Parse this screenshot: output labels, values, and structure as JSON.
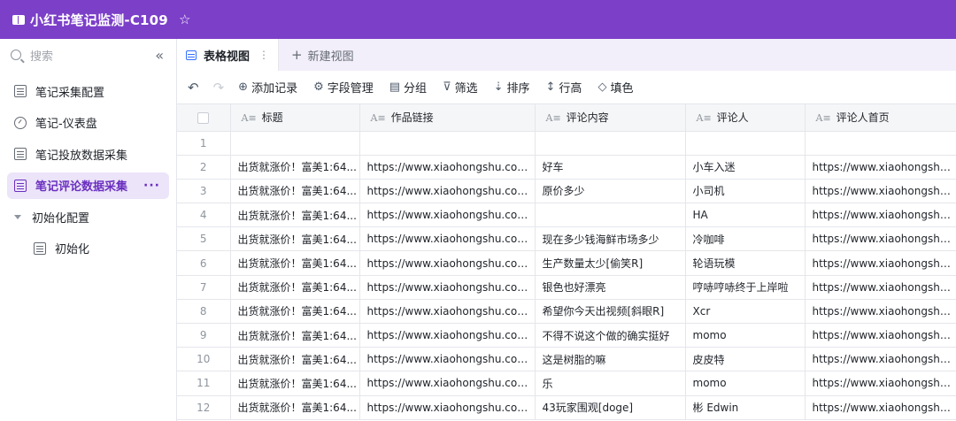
{
  "app": {
    "title": "小红书笔记监测-C109"
  },
  "sidebar": {
    "search_placeholder": "搜索",
    "collapse_glyph": "«",
    "items": [
      {
        "label": "笔记采集配置"
      },
      {
        "label": "笔记-仪表盘"
      },
      {
        "label": "笔记投放数据采集"
      },
      {
        "label": "笔记评论数据采集"
      },
      {
        "label": "初始化配置"
      },
      {
        "label": "初始化"
      }
    ]
  },
  "tabs": {
    "active": "表格视图",
    "new_view": "新建视图"
  },
  "toolbar": {
    "add_record": "添加记录",
    "field_manage": "字段管理",
    "group": "分组",
    "filter": "筛选",
    "sort": "排序",
    "row_height": "行高",
    "fill": "填色"
  },
  "table": {
    "columns": [
      "标题",
      "作品链接",
      "评论内容",
      "评论人",
      "评论人首页"
    ],
    "rows": [
      {
        "n": "1",
        "title": "",
        "link": "",
        "comment": "",
        "user": "",
        "home": ""
      },
      {
        "n": "2",
        "title": "出货就涨价！富美1:64...",
        "link": "https://www.xiaohongshu.com/dis...",
        "comment": "好车",
        "user": "小车入迷",
        "home": "https://www.xiaohongshu.co..."
      },
      {
        "n": "3",
        "title": "出货就涨价！富美1:64...",
        "link": "https://www.xiaohongshu.com/dis...",
        "comment": "原价多少",
        "user": "小司机",
        "home": "https://www.xiaohongshu.co..."
      },
      {
        "n": "4",
        "title": "出货就涨价！富美1:64...",
        "link": "https://www.xiaohongshu.com/dis...",
        "comment": "",
        "user": "HA",
        "home": "https://www.xiaohongshu.co..."
      },
      {
        "n": "5",
        "title": "出货就涨价！富美1:64...",
        "link": "https://www.xiaohongshu.com/dis...",
        "comment": "现在多少钱海鲜市场多少",
        "user": "冷咖啡",
        "home": "https://www.xiaohongshu.co..."
      },
      {
        "n": "6",
        "title": "出货就涨价！富美1:64...",
        "link": "https://www.xiaohongshu.com/dis...",
        "comment": "生产数量太少[偷笑R]",
        "user": "轮语玩模",
        "home": "https://www.xiaohongshu.co..."
      },
      {
        "n": "7",
        "title": "出货就涨价！富美1:64...",
        "link": "https://www.xiaohongshu.com/dis...",
        "comment": "银色也好漂亮",
        "user": "哼哧哼哧终于上岸啦",
        "home": "https://www.xiaohongshu.co..."
      },
      {
        "n": "8",
        "title": "出货就涨价！富美1:64...",
        "link": "https://www.xiaohongshu.com/dis...",
        "comment": "希望你今天出视频[斜眼R]",
        "user": "Xcr",
        "home": "https://www.xiaohongshu.co..."
      },
      {
        "n": "9",
        "title": "出货就涨价！富美1:64...",
        "link": "https://www.xiaohongshu.com/dis...",
        "comment": "不得不说这个做的确实挺好",
        "user": "momo",
        "home": "https://www.xiaohongshu.co..."
      },
      {
        "n": "10",
        "title": "出货就涨价！富美1:64...",
        "link": "https://www.xiaohongshu.com/dis...",
        "comment": "这是树脂的嘛",
        "user": "皮皮特",
        "home": "https://www.xiaohongshu.co..."
      },
      {
        "n": "11",
        "title": "出货就涨价！富美1:64...",
        "link": "https://www.xiaohongshu.com/dis...",
        "comment": "乐",
        "user": "momo",
        "home": "https://www.xiaohongshu.co..."
      },
      {
        "n": "12",
        "title": "出货就涨价！富美1:64...",
        "link": "https://www.xiaohongshu.com/dis...",
        "comment": "43玩家围观[doge]",
        "user": "彬 Edwin",
        "home": "https://www.xiaohongshu.co..."
      }
    ]
  }
}
